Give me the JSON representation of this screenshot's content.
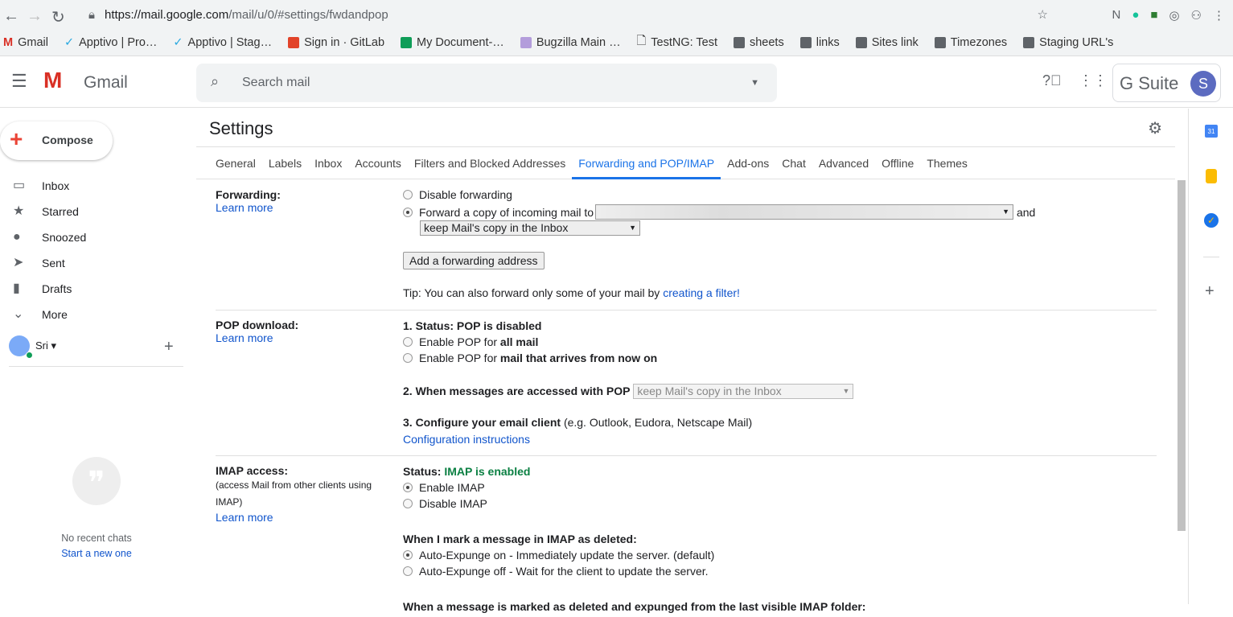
{
  "browser": {
    "url_host": "https://mail.google.com",
    "url_path": "/mail/u/0/#settings/fwdandpop",
    "bookmarks": [
      "Gmail",
      "Apptivo | Pro…",
      "Apptivo | Stag…",
      "Sign in · GitLab",
      "My Document-…",
      "Bugzilla Main …",
      "TestNG: Test",
      "sheets",
      "links",
      "Sites link",
      "Timezones",
      "Staging URL's"
    ]
  },
  "header": {
    "app": "Gmail",
    "search_placeholder": "Search mail",
    "gsuite": "G Suite",
    "avatar": "S"
  },
  "sidebar": {
    "compose": "Compose",
    "items": [
      "Inbox",
      "Starred",
      "Snoozed",
      "Sent",
      "Drafts",
      "More"
    ],
    "user": "Sri",
    "no_chats": "No recent chats",
    "start_new": "Start a new one"
  },
  "settings": {
    "title": "Settings",
    "tabs": [
      "General",
      "Labels",
      "Inbox",
      "Accounts",
      "Filters and Blocked Addresses",
      "Forwarding and POP/IMAP",
      "Add-ons",
      "Chat",
      "Advanced",
      "Offline",
      "Themes"
    ],
    "forwarding": {
      "label": "Forwarding:",
      "learn": "Learn more",
      "disable": "Disable forwarding",
      "forward": "Forward a copy of incoming mail to",
      "and": "and",
      "keep": "keep Mail's copy in the Inbox",
      "add": "Add a forwarding address",
      "tip": "Tip: You can also forward only some of your mail by",
      "tip_link": "creating a filter!"
    },
    "pop": {
      "label": "POP download:",
      "learn": "Learn more",
      "status": "1. Status: POP is disabled",
      "all_pre": "Enable POP for",
      "all": "all mail",
      "now_pre": "Enable POP for",
      "now": "mail that arrives from now on",
      "accessed": "2. When messages are accessed with POP",
      "accessed_sel": "keep Mail's copy in the Inbox",
      "configure": "3. Configure your email client",
      "configure_eg": "(e.g. Outlook, Eudora, Netscape Mail)",
      "instructions": "Configuration instructions"
    },
    "imap": {
      "label": "IMAP access:",
      "sub": "(access Mail from other clients using IMAP)",
      "learn": "Learn more",
      "status_pre": "Status:",
      "status": "IMAP is enabled",
      "enable": "Enable IMAP",
      "disable": "Disable IMAP",
      "deleted": "When I mark a message in IMAP as deleted:",
      "exp_on": "Auto-Expunge on - Immediately update the server. (default)",
      "exp_off": "Auto-Expunge off - Wait for the client to update the server.",
      "expunged": "When a message is marked as deleted and expunged from the last visible IMAP folder:"
    }
  },
  "colors": {
    "accent": "#1a73e8",
    "enabled": "#0b8043"
  }
}
